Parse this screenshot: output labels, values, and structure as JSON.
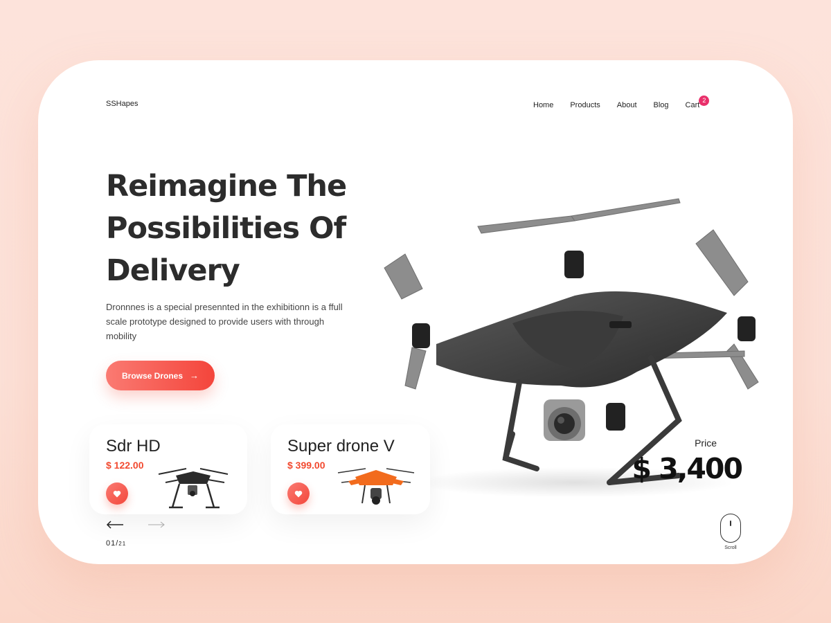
{
  "brand": {
    "name": "SSHapes"
  },
  "nav": {
    "items": [
      "Home",
      "Products",
      "About",
      "Blog"
    ],
    "cart_label": "Cart",
    "cart_count": "2"
  },
  "hero": {
    "headline": "Reimagine The\nPossibilities Of\nDelivery",
    "description": "Dronnnes  is a special presennted in the exhibitionn is a ffull scale prototype designed to provide  users with through mobility",
    "cta_label": "Browse Drones",
    "cta_icon": "arrow-right-icon"
  },
  "featured": {
    "price_label": "Price",
    "price_value": "$ 3,400"
  },
  "products": [
    {
      "name": "Sdr HD",
      "price": "$ 122.00",
      "color": "#2b2b2b"
    },
    {
      "name": "Super drone V",
      "price": "$ 399.00",
      "color": "#f26b1d"
    }
  ],
  "pager": {
    "current": "01/",
    "total": "21"
  },
  "scroll": {
    "label": "Scroll"
  },
  "colors": {
    "accent": "#f4453b",
    "badge": "#e9306b"
  }
}
